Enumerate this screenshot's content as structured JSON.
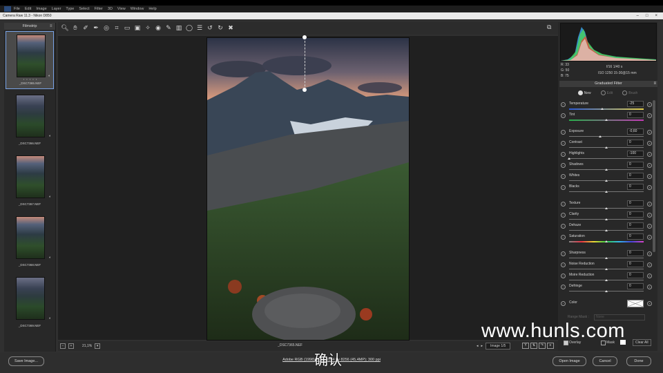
{
  "menubar": {
    "items": [
      "File",
      "Edit",
      "Image",
      "Layer",
      "Type",
      "Select",
      "Filter",
      "3D",
      "View",
      "Window",
      "Help"
    ]
  },
  "titlebar": {
    "title": "Camera Raw 11.3  -  Nikon D850",
    "controls": [
      "–",
      "□",
      "×"
    ]
  },
  "filmstrip": {
    "header": "Filmstrip",
    "items": [
      {
        "name": "_DSC7365.NEF",
        "stars": "• • • • •",
        "selected": true
      },
      {
        "name": "_DSC7366.NEF"
      },
      {
        "name": "_DSC7367.NEF"
      },
      {
        "name": "_DSC7368.NEF"
      },
      {
        "name": "_DSC7369.NEF"
      }
    ]
  },
  "toolbar": {
    "tools": [
      "zoom-tool",
      "hand-tool",
      "white-balance-tool",
      "color-sampler-tool",
      "targeted-adjustment-tool",
      "crop-tool",
      "straighten-tool",
      "transform-tool",
      "spot-removal-tool",
      "red-eye-tool",
      "adjustment-brush-tool",
      "graduated-filter-tool",
      "radial-filter-tool",
      "preferences",
      "rotate-ccw",
      "rotate-cw",
      "trash"
    ]
  },
  "canvas": {
    "zoom": "21,1%",
    "filename": "_DSC7365.NEF",
    "image_counter": "Image 1/5"
  },
  "histogram": {
    "rgb": {
      "r": "R:   33",
      "g": "G:   50",
      "b": "B:   75"
    },
    "exposure": "f/16   1/40 s",
    "iso": "ISO 1250   15-30@15 mm"
  },
  "panel": {
    "title": "Graduated Filter",
    "modes": {
      "new": "New",
      "edit": "Edit",
      "brush": "Brush"
    },
    "sliders": [
      {
        "label": "Temperature",
        "value": "-25",
        "pos": 0.44,
        "track": "temp"
      },
      {
        "label": "Tint",
        "value": "0",
        "pos": 0.5,
        "track": "tint"
      },
      {
        "label": "Exposure",
        "value": "-0,60",
        "pos": 0.42
      },
      {
        "label": "Contrast",
        "value": "0",
        "pos": 0.5
      },
      {
        "label": "Highlights",
        "value": "-100",
        "pos": 0.0
      },
      {
        "label": "Shadows",
        "value": "0",
        "pos": 0.5
      },
      {
        "label": "Whites",
        "value": "0",
        "pos": 0.5
      },
      {
        "label": "Blacks",
        "value": "0",
        "pos": 0.5
      },
      {
        "label": "Texture",
        "value": "0",
        "pos": 0.5
      },
      {
        "label": "Clarity",
        "value": "0",
        "pos": 0.5
      },
      {
        "label": "Dehaze",
        "value": "0",
        "pos": 0.5
      },
      {
        "label": "Saturation",
        "value": "0",
        "pos": 0.5,
        "track": "sat"
      },
      {
        "label": "Sharpness",
        "value": "0",
        "pos": 0.5
      },
      {
        "label": "Noise Reduction",
        "value": "0",
        "pos": 0.5
      },
      {
        "label": "Moire Reduction",
        "value": "0",
        "pos": 0.5
      },
      {
        "label": "Defringe",
        "value": "0",
        "pos": 0.5
      }
    ],
    "color_label": "Color",
    "range_mask_label": "Range Mask :",
    "range_mask_value": "None",
    "overlay_label": "Overlay",
    "mask_label": "Mask",
    "clear_all": "Clear All"
  },
  "footer": {
    "save_image": "Save Image...",
    "workflow": "Adobe RGB (1998); 8 bit; 5504 by 8256 (45,4MP); 300 ppi",
    "open_image": "Open Image",
    "cancel": "Cancel",
    "done": "Done"
  },
  "watermark": "www.hunls.com",
  "subtitle": "确认"
}
